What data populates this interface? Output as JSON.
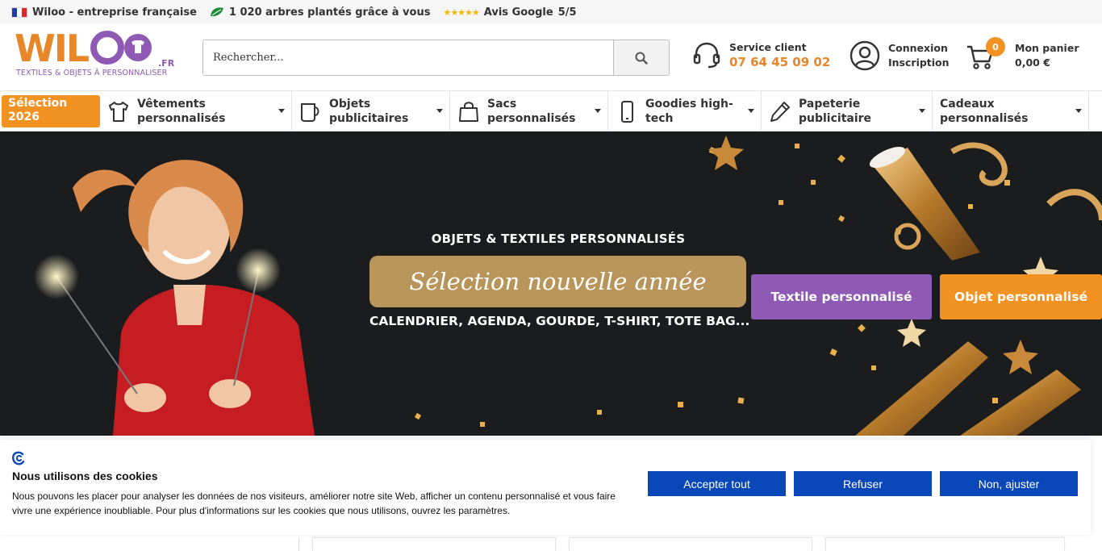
{
  "topbar": {
    "company": "Wiloo - entreprise française",
    "trees": "1 020 arbres plantés grâce à vous",
    "stars": "★★★★★",
    "review_label": "Avis Google",
    "rating": "5/5"
  },
  "header": {
    "logo_word": "WILOO",
    "logo_tld": ".FR",
    "logo_tagline": "TEXTILES & OBJETS À PERSONNALISER",
    "search_placeholder": "Rechercher...",
    "service_label": "Service client",
    "service_phone": "07 64 45 09 02",
    "account_line1": "Connexion",
    "account_line2": "Inscription",
    "cart_count": "0",
    "cart_label": "Mon panier",
    "cart_total": "0,00 €"
  },
  "nav": {
    "highlight": {
      "line1": "Sélection",
      "line2": "2026"
    },
    "items": [
      {
        "line1": "Vêtements",
        "line2": "personnalisés",
        "icon": "tshirt-icon"
      },
      {
        "line1": "Objets",
        "line2": "publicitaires",
        "icon": "mug-icon"
      },
      {
        "line1": "Sacs",
        "line2": "personnalisés",
        "icon": "bag-icon"
      },
      {
        "line1": "Goodies high-",
        "line2": "tech",
        "icon": "phone-icon"
      },
      {
        "line1": "Papeterie",
        "line2": "publicitaire",
        "icon": "pen-icon"
      },
      {
        "line1": "Cadeaux",
        "line2": "personnalisés",
        "icon": ""
      }
    ]
  },
  "hero": {
    "kicker": "OBJETS & TEXTILES PERSONNALISÉS",
    "banner": "Sélection nouvelle année",
    "subtitle": "CALENDRIER, AGENDA, GOURDE, T-SHIRT, TOTE BAG...",
    "btn_textile": "Textile personnalisé",
    "btn_objet": "Objet personnalisé"
  },
  "cookie": {
    "title": "Nous utilisons des cookies",
    "text": "Nous pouvons les placer pour analyser les données de nos visiteurs, améliorer notre site Web, afficher un contenu personnalisé et vous faire vivre une expérience inoubliable. Pour plus d'informations sur les cookies que nous utilisons, ouvrez les paramètres.",
    "accept": "Accepter tout",
    "refuse": "Refuser",
    "adjust": "Non, ajuster"
  },
  "colors": {
    "brand_orange": "#f29222",
    "brand_purple": "#8e5ab3",
    "gold": "#b8955a",
    "cookie_blue": "#0a47b8"
  }
}
